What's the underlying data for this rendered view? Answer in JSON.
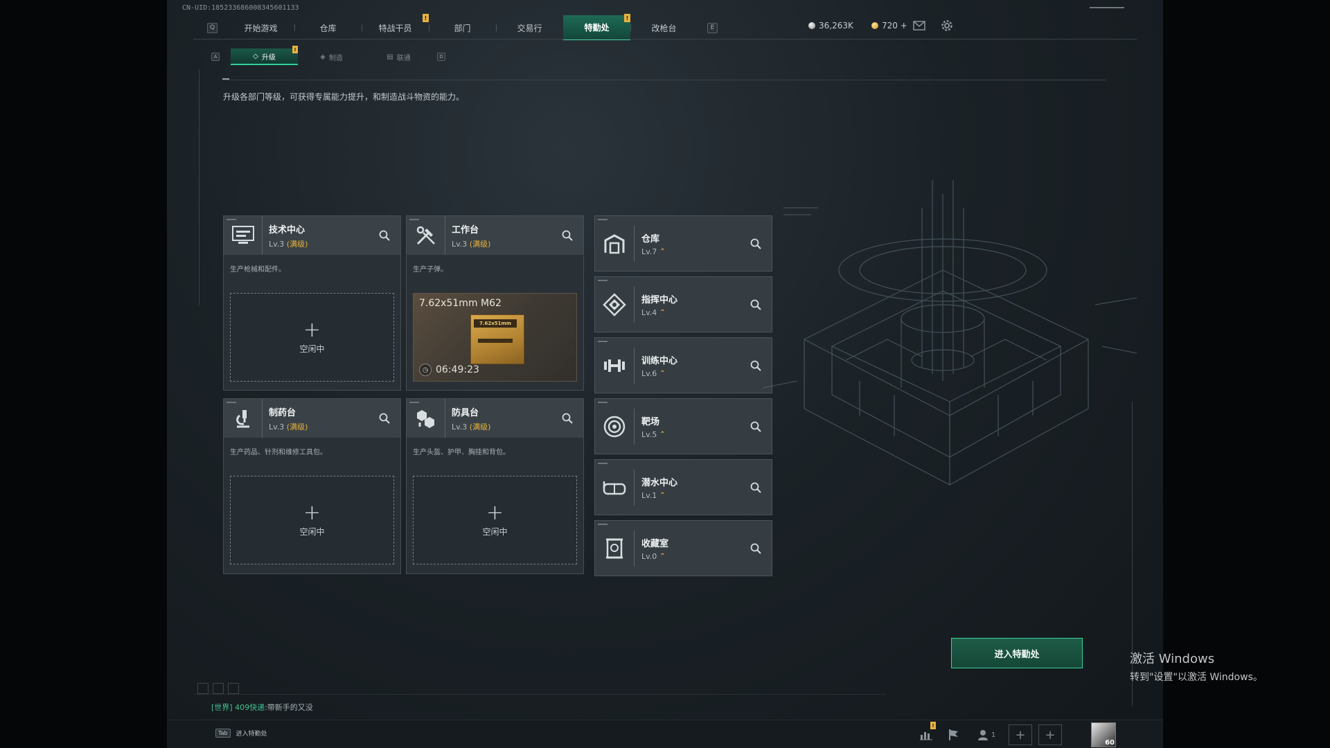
{
  "header": {
    "uid": "CN-UID:185233686008345601133",
    "nav_prev_key": "Q",
    "nav_next_key": "E",
    "tabs": [
      "开始游戏",
      "仓库",
      "特战干员",
      "部门",
      "交易行",
      "特勤处",
      "改枪台"
    ],
    "active_tab": "特勤处",
    "currency_1": "36,263K",
    "currency_2": "720 +"
  },
  "subnav": {
    "prev_key": "A",
    "next_key": "D",
    "tabs": [
      "升级",
      "制造",
      "联通"
    ]
  },
  "description": "升级各部门等级，可获得专属能力提升，和制造战斗物资的能力。",
  "production_cards": [
    {
      "title": "技术中心",
      "level": "Lv.3",
      "max": "(满级)",
      "desc": "生产枪械和配件。",
      "slot": "空闲中"
    },
    {
      "title": "工作台",
      "level": "Lv.3",
      "max": "(满级)",
      "desc": "生产子弹。",
      "item": "7.62x51mm M62",
      "box_label": "7.62x51mm",
      "timer": "06:49:23"
    },
    {
      "title": "制药台",
      "level": "Lv.3",
      "max": "(满级)",
      "desc": "生产药品、针剂和维修工具包。",
      "slot": "空闲中"
    },
    {
      "title": "防具台",
      "level": "Lv.3",
      "max": "(满级)",
      "desc": "生产头盔、护甲、胸挂和背包。",
      "slot": "空闲中"
    }
  ],
  "slot_plus": "+",
  "upgrade_symbol": "⌃",
  "departments": [
    {
      "title": "仓库",
      "level": "Lv.7"
    },
    {
      "title": "指挥中心",
      "level": "Lv.4"
    },
    {
      "title": "训练中心",
      "level": "Lv.6"
    },
    {
      "title": "靶场",
      "level": "Lv.5"
    },
    {
      "title": "潜水中心",
      "level": "Lv.1"
    },
    {
      "title": "收藏室",
      "level": "Lv.0"
    }
  ],
  "enter_button": "进入特勤处",
  "chat": {
    "channel": "[世界]",
    "name": "409快递",
    "message": ":带新手的又没"
  },
  "bottom": {
    "tab_key": "Tab",
    "tab_label": "进入特勤处",
    "friends_count": "1",
    "avatar_level": "60"
  },
  "watermark": {
    "line1": "激活 Windows",
    "line2": "转到\"设置\"以激活 Windows。"
  },
  "colors": {
    "accent": "#31d19a",
    "max_level": "#e5b23b",
    "notif": "#e7b23f"
  }
}
